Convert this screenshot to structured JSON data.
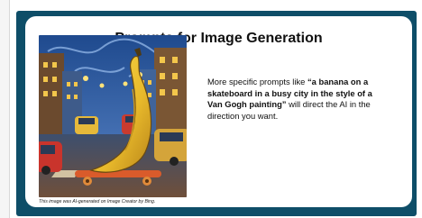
{
  "slide": {
    "title": "Prompts for Image Generation",
    "caption": "This image was AI-generated on Image Creator by Bing.",
    "body_before": "More specific prompts like ",
    "body_bold": "“a banana on a skateboard in a busy city in the style of a Van Gogh painting”",
    "body_after": " will direct the AI in the direction you want."
  },
  "colors": {
    "frame": "#0e4e68",
    "card": "#ffffff"
  }
}
